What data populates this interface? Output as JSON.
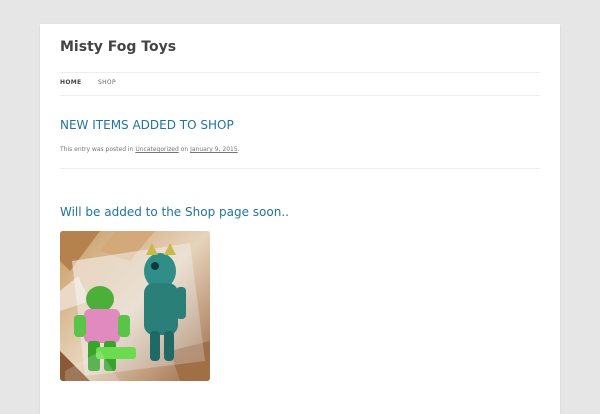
{
  "site": {
    "title": "Misty Fog Toys"
  },
  "nav": {
    "items": [
      {
        "label": "HOME",
        "active": true
      },
      {
        "label": "SHOP",
        "active": false
      }
    ]
  },
  "post": {
    "title": "NEW ITEMS ADDED TO SHOP",
    "meta_prefix": "This entry was posted in ",
    "category": "Uncategorized",
    "meta_on": " on ",
    "date": "January 9, 2015",
    "meta_suffix": ".",
    "heading": "Will be added to the Shop page soon..",
    "image_description": "photo of two toy figures in plastic bags"
  },
  "colors": {
    "background": "#e6e6e6",
    "page": "#ffffff",
    "link": "#21759b",
    "text": "#444444",
    "meta": "#757575"
  }
}
